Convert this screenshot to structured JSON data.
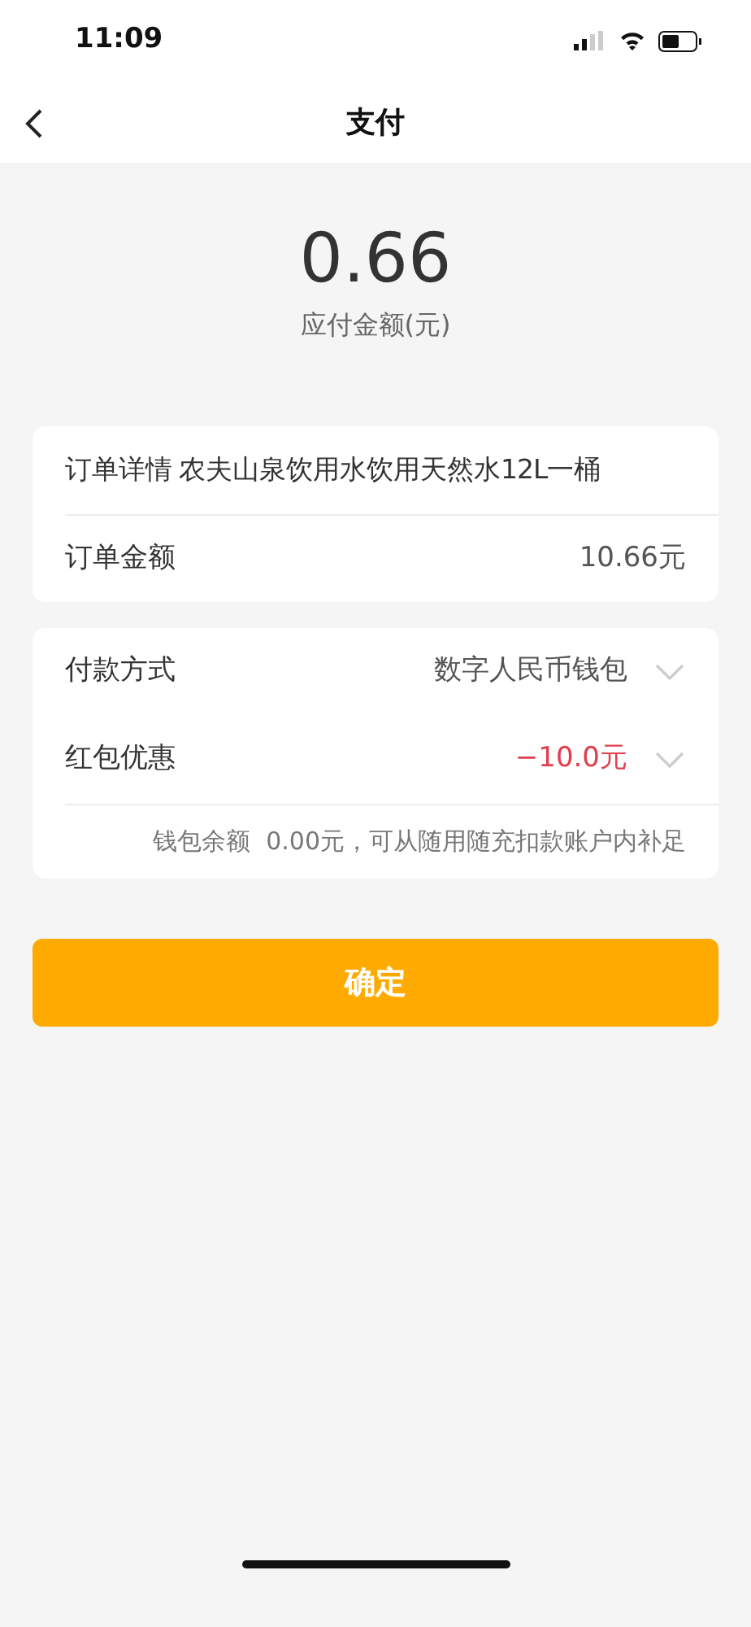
{
  "status_bar": {
    "time": "11:09"
  },
  "nav": {
    "title": "支付"
  },
  "amount": {
    "value": "0.66",
    "label": "应付金额(元)"
  },
  "order_rows": [
    {
      "kind": "inline",
      "label": "订单详情",
      "value": "农夫山泉饮用水饮用天然水12L一桶"
    },
    {
      "kind": "split",
      "label": "订单金额",
      "value": "10.66元"
    }
  ],
  "payment_rows": [
    {
      "kind": "select",
      "label": "付款方式",
      "value": "数字人民币钱包",
      "color": "#555555"
    },
    {
      "kind": "select",
      "label": "红包优惠",
      "value": "−10.0元",
      "color": "#e0404e"
    }
  ],
  "note": "钱包余额  0.00元，可从随用随充扣款账户内补足",
  "confirm_button": "确定"
}
